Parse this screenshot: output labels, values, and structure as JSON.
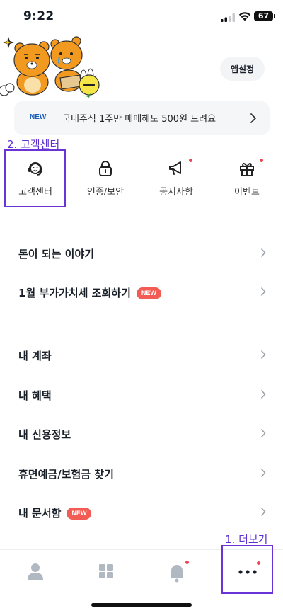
{
  "status_bar": {
    "time": "9:22",
    "battery": "67"
  },
  "header": {
    "settings_label": "앱설정"
  },
  "banner": {
    "badge": "NEW",
    "text": "국내주식 1주만 매매해도 500원 드려요"
  },
  "annotations": {
    "customer_center_label": "2. 고객센터",
    "more_label": "1. 더보기"
  },
  "quick_menu": [
    {
      "label": "고객센터",
      "icon": "headset-smile-icon",
      "dot": false
    },
    {
      "label": "인증/보안",
      "icon": "lock-icon",
      "dot": false
    },
    {
      "label": "공지사항",
      "icon": "megaphone-icon",
      "dot": true
    },
    {
      "label": "이벤트",
      "icon": "gift-icon",
      "dot": true
    }
  ],
  "list": [
    {
      "label": "돈이 되는 이야기",
      "new": false
    },
    {
      "label": "1월 부가가치세 조회하기",
      "new": true
    },
    {
      "label": "내 계좌",
      "new": false
    },
    {
      "label": "내 혜택",
      "new": false
    },
    {
      "label": "내 신용정보",
      "new": false
    },
    {
      "label": "휴면예금/보험금 찾기",
      "new": false
    },
    {
      "label": "내 문서함",
      "new": true
    }
  ],
  "new_badge_text": "NEW",
  "tab_bar": [
    {
      "icon": "person-icon",
      "dot": false
    },
    {
      "icon": "grid-icon",
      "dot": false
    },
    {
      "icon": "bell-icon",
      "dot": true
    },
    {
      "icon": "more-dots-icon",
      "dot": true
    }
  ],
  "colors": {
    "accent_annotation": "#6a33d6",
    "new_badge": "#f25c54",
    "dot": "#f04452",
    "banner_badge": "#1b5fb8"
  }
}
